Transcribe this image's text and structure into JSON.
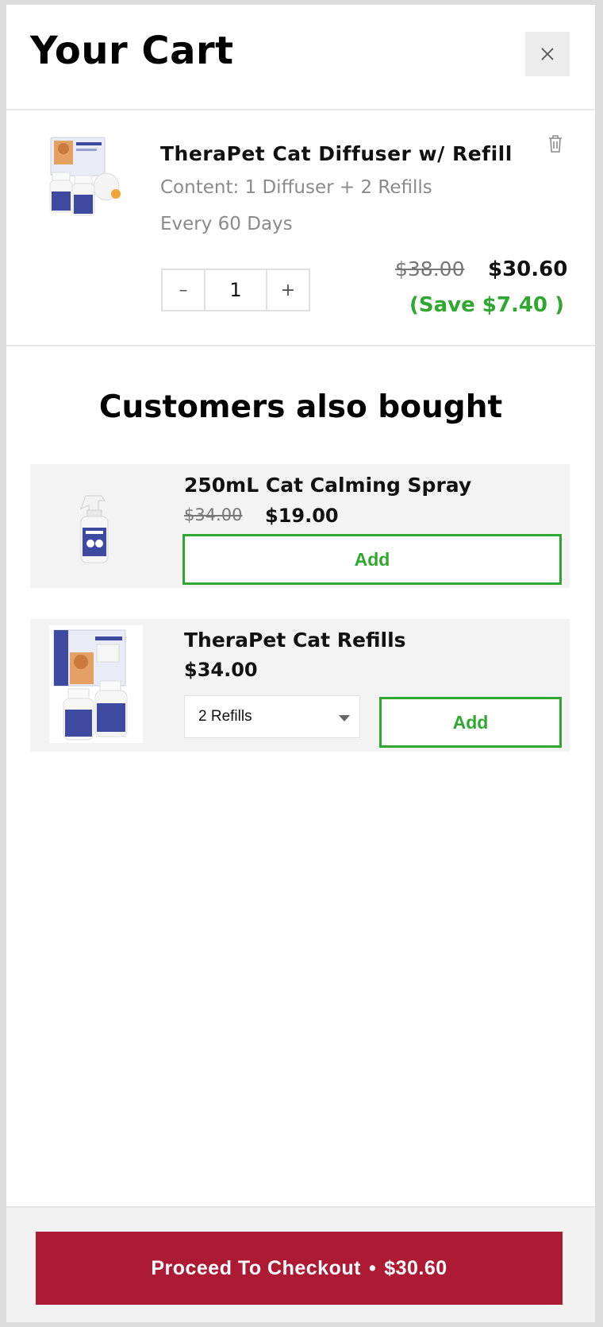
{
  "header": {
    "title": "Your Cart",
    "close_icon": "close-icon"
  },
  "cart_item": {
    "title": "TheraPet Cat Diffuser w/ Refill",
    "content": "Content: 1 Diffuser + 2 Refills",
    "frequency": "Every 60 Days",
    "quantity": "1",
    "minus": "–",
    "plus": "+",
    "price_old": "$38.00",
    "price_new": "$30.60",
    "save": "(Save $7.40 )"
  },
  "upsell": {
    "heading": "Customers also bought",
    "items": [
      {
        "title": "250mL Cat Calming Spray",
        "price_old": "$34.00",
        "price_new": "$19.00",
        "add_label": "Add"
      },
      {
        "title": "TheraPet Cat Refills",
        "price_new": "$34.00",
        "select_value": "2 Refills",
        "add_label": "Add"
      }
    ]
  },
  "footer": {
    "checkout_label": "Proceed To Checkout",
    "separator": "•",
    "checkout_total": "$30.60"
  },
  "colors": {
    "accent": "#ad1a33",
    "success": "#2ea82e",
    "panel_bg": "#f3f3f3"
  }
}
